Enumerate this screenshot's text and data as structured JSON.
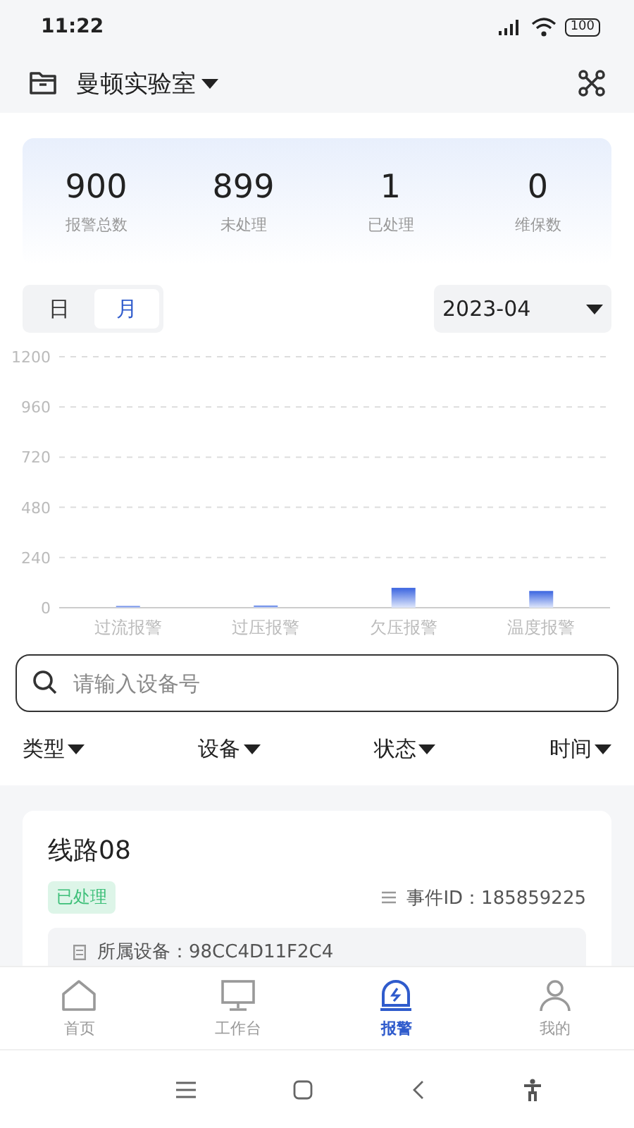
{
  "status_bar": {
    "time": "11:22",
    "battery": "100"
  },
  "header": {
    "title": "曼顿实验室"
  },
  "stats": [
    {
      "value": "900",
      "label": "报警总数"
    },
    {
      "value": "899",
      "label": "未处理"
    },
    {
      "value": "1",
      "label": "已处理"
    },
    {
      "value": "0",
      "label": "维保数"
    }
  ],
  "period_tabs": [
    {
      "label": "日",
      "selected": false
    },
    {
      "label": "月",
      "selected": true
    }
  ],
  "date_select": {
    "value": "2023-04"
  },
  "chart": {
    "chart_data": {
      "type": "bar",
      "categories": [
        "过流报警",
        "过压报警",
        "欠压报警",
        "温度报警"
      ],
      "values": [
        8,
        10,
        95,
        80
      ],
      "ylim": [
        0,
        1200
      ],
      "grid": true,
      "yticks": [
        0,
        240,
        480,
        720,
        960,
        1200
      ]
    }
  },
  "search": {
    "placeholder": "请输入设备号"
  },
  "filters": [
    "类型",
    "设备",
    "状态",
    "时间"
  ],
  "events": [
    {
      "title": "线路08",
      "status": "已处理",
      "event_id": "事件ID：185859225",
      "device": "所属设备：98CC4D11F2C4"
    }
  ],
  "bottom_nav": [
    {
      "label": "首页",
      "kind": "home",
      "selected": false
    },
    {
      "label": "工作台",
      "kind": "desk",
      "selected": false
    },
    {
      "label": "报警",
      "kind": "alarm",
      "selected": true
    },
    {
      "label": "我的",
      "kind": "user",
      "selected": false
    }
  ]
}
